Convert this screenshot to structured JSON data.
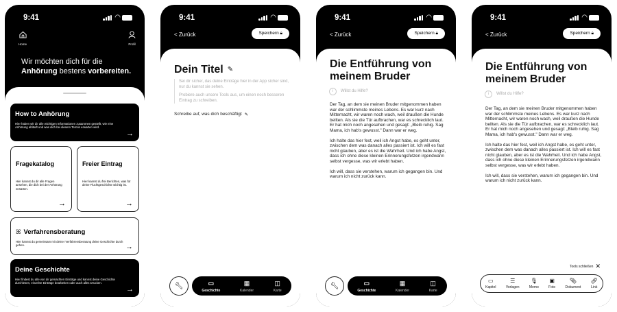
{
  "status": {
    "time": "9:41"
  },
  "screen1": {
    "home_label": "Home",
    "profile_label": "Profil",
    "headline_line1": "Wir möchten dich für die",
    "headline_bold1": "Anhörung",
    "headline_mid": " bestens ",
    "headline_bold2": "vorbereiten.",
    "cards": {
      "how": {
        "title": "How to Anhörung",
        "desc": "Hier haben wir dir alle wichtigen Informationen zusammen gestellt, wie eine Anhörung abläuft und was dich bei diesem Termin erwarten wird."
      },
      "fragen": {
        "title": "Fragekatalog",
        "desc": "Hier kannst du dir alle Fragen ansehen, die dich bei der Anhörung erwarten."
      },
      "frei": {
        "title": "Freier Eintrag",
        "desc": "Hier kannst du frei Berichten, was für deine Fluchtgeschichte wichtig ist."
      },
      "verfahren": {
        "title": "Verfahrensberatung",
        "desc": "Hier kannst du gemeinsam mit deiner Verfahrensberatung deine Geschichte durch gehen."
      },
      "geschichte": {
        "title": "Deine Geschichte",
        "desc": "Hier findest du alle von dir gemachten Einträge und kannst deine Geschichte durchlesen, einzelne Einträge bearbeiten oder auch alles Drucken."
      }
    }
  },
  "nav": {
    "back": "< Zurück",
    "save": "Speichern"
  },
  "screen2": {
    "title": "Dein Titel",
    "hint1": "Sei dir sicher, das deine Einträge hier in der App sicher sind, nur du kannst sie sehen.",
    "hint2": "Probiere auch unsere Tools aus, um einen noch besseren Eintrag zu schreiben.",
    "prompt": "Schreibe auf, was dich beschäftigt"
  },
  "tabs": {
    "geschichte": "Geschichte",
    "kalender": "Kalender",
    "karte": "Karte"
  },
  "story": {
    "title_line1": "Die Entführung von",
    "title_line2": "meinem Bruder",
    "help": "Willst du Hilfe?",
    "p1": "Der Tag, an dem sie meinen Bruder mitgenommen haben war der schlimmste meines Lebens. Es war kurz nach Mitternacht, wir waren noch wach, weil draußen die Hunde bellten. Als sie die Tür aufbrachen, war es schrecklich laut. Er hat mich noch angesehen und gesagt: „Bleib ruhig. Sag Mama, ich hab's gewusst.\" Dann war er weg.",
    "p2": "Ich halte das hier fest, weil ich Angst habe, es geht unter, zwischen dem was danach alles passiert ist. Ich will es fast nicht glauben, aber es ist die Wahrheit. Und ich habe Angst, dass ich ohne diese kleinen Erinnerungsfetzen irgendwann selbst vergesse, was wir erlebt haben.",
    "p3": "Ich will, dass sie verstehen, warum ich gegangen bin. Und warum ich nicht zurück kann."
  },
  "tools": {
    "close": "Tools schließen",
    "kapitel": "Kapitel",
    "vorlagen": "Vorlagen",
    "memo": "Memo",
    "foto": "Foto",
    "dokument": "Dokument",
    "link": "Link"
  },
  "colors": {
    "primary": "#000000",
    "surface": "#ffffff",
    "hint": "#aaaaaa"
  }
}
